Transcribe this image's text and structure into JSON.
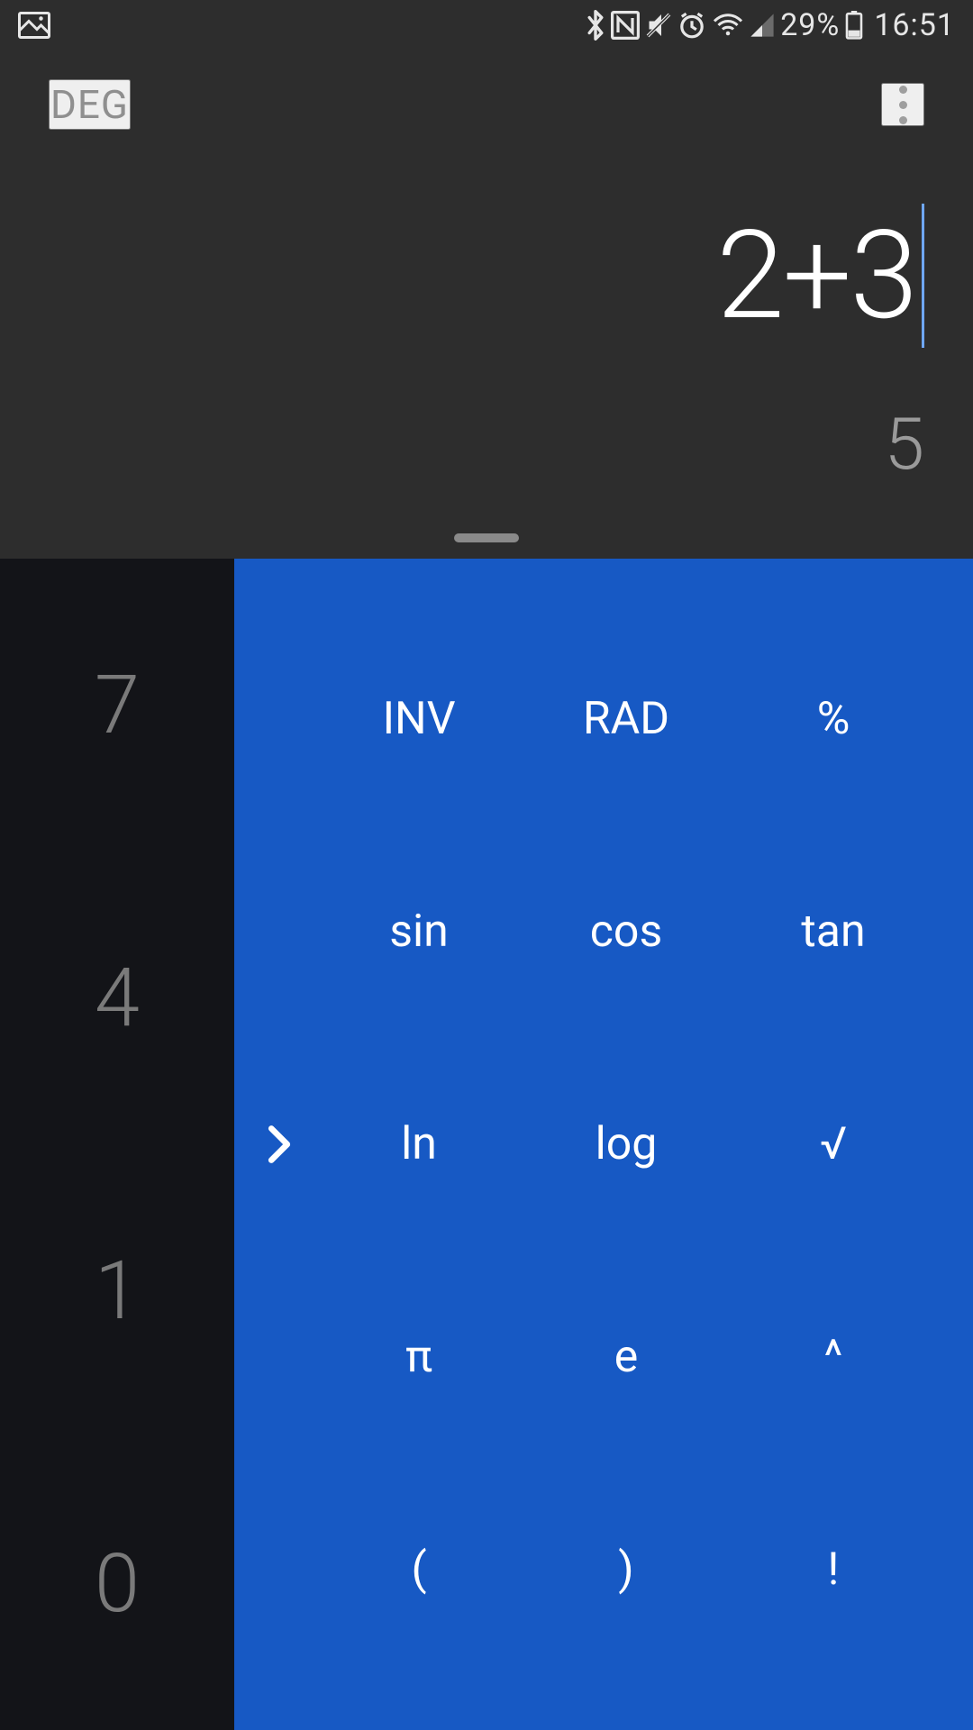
{
  "status": {
    "battery_pct": "29%",
    "time": "16:51"
  },
  "header": {
    "angle_mode": "DEG"
  },
  "display": {
    "expression": "2+3",
    "result": "5"
  },
  "digits": {
    "r1": "7",
    "r2": "4",
    "r3": "1",
    "r4": "0"
  },
  "advanced": {
    "row1": {
      "c1": "INV",
      "c2": "RAD",
      "c3": "%"
    },
    "row2": {
      "c1": "sin",
      "c2": "cos",
      "c3": "tan"
    },
    "row3": {
      "c1": "ln",
      "c2": "log",
      "c3": "√"
    },
    "row4": {
      "c1": "π",
      "c2": "e",
      "c3": "^"
    },
    "row5": {
      "c1": "(",
      "c2": ")",
      "c3": "!"
    }
  }
}
